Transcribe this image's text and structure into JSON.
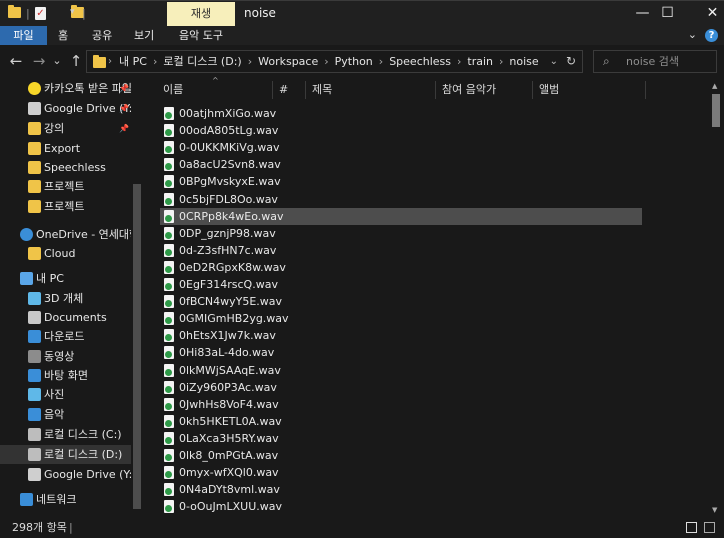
{
  "titlebar": {
    "context_tab": "재생",
    "title": "noise",
    "min_glyph": "—",
    "max_glyph": "☐",
    "close_glyph": "✕"
  },
  "ribbon": {
    "tabs": [
      "파일",
      "홈",
      "공유",
      "보기",
      "음악 도구"
    ],
    "help_glyph": "?"
  },
  "nav": {
    "back": "←",
    "forward": "→",
    "recent": "⌄",
    "up": "↑",
    "breadcrumb": [
      "내 PC",
      "로컬 디스크 (D:)",
      "Workspace",
      "Python",
      "Speechless",
      "train",
      "noise"
    ],
    "search_placeholder": "noise 검색"
  },
  "sidebar": {
    "items": [
      {
        "label": "카카오톡 받은 파일",
        "icon": "kakaotalk-icon",
        "pinned": true
      },
      {
        "label": "Google Drive (Y:)",
        "icon": "drive-icon",
        "pinned": true
      },
      {
        "label": "강의",
        "icon": "folder-icon",
        "pinned": true
      },
      {
        "label": "Export",
        "icon": "folder-icon",
        "pinned": false
      },
      {
        "label": "Speechless",
        "icon": "folder-icon",
        "pinned": false
      },
      {
        "label": "프로젝트",
        "icon": "folder-icon",
        "pinned": false
      },
      {
        "label": "프로젝트",
        "icon": "folder-icon",
        "pinned": false
      },
      {
        "label": "OneDrive - 연세대학교",
        "icon": "onedrive-icon",
        "pinned": false
      },
      {
        "label": "Cloud",
        "icon": "folder-icon",
        "pinned": false
      },
      {
        "label": "내 PC",
        "icon": "pc-icon",
        "pinned": false
      },
      {
        "label": "3D 개체",
        "icon": "3d-objects-icon",
        "pinned": false
      },
      {
        "label": "Documents",
        "icon": "documents-icon",
        "pinned": false
      },
      {
        "label": "다운로드",
        "icon": "download-icon",
        "pinned": false
      },
      {
        "label": "동영상",
        "icon": "video-icon",
        "pinned": false
      },
      {
        "label": "바탕 화면",
        "icon": "desktop-icon",
        "pinned": false
      },
      {
        "label": "사진",
        "icon": "pictures-icon",
        "pinned": false
      },
      {
        "label": "음악",
        "icon": "music-icon",
        "pinned": false
      },
      {
        "label": "로컬 디스크 (C:)",
        "icon": "disk-icon",
        "pinned": false
      },
      {
        "label": "로컬 디스크 (D:)",
        "icon": "disk-icon",
        "pinned": false,
        "selected": true
      },
      {
        "label": "Google Drive (Y:)",
        "icon": "drive-icon",
        "pinned": false
      },
      {
        "label": "네트워크",
        "icon": "network-icon",
        "pinned": false
      }
    ]
  },
  "columns": [
    "이름",
    "#",
    "제목",
    "참여 음악가",
    "앨범"
  ],
  "files": [
    "00atjhmXiGo.wav",
    "00odA805tLg.wav",
    "0-0UKKMKiVg.wav",
    "0a8acU2Svn8.wav",
    "0BPgMvskyxE.wav",
    "0c5bjFDL8Oo.wav",
    "0CRPp8k4wEo.wav",
    "0DP_gznjP98.wav",
    "0d-Z3sfHN7c.wav",
    "0eD2RGpxK8w.wav",
    "0EgF314rscQ.wav",
    "0fBCN4wyY5E.wav",
    "0GMIGmHB2yg.wav",
    "0hEtsX1Jw7k.wav",
    "0Hi83aL-4do.wav",
    "0lkMWjSAAqE.wav",
    "0iZy960P3Ac.wav",
    "0JwhHs8VoF4.wav",
    "0kh5HKETL0A.wav",
    "0LaXca3H5RY.wav",
    "0lk8_0mPGtA.wav",
    "0myx-wfXQl0.wav",
    "0N4aDYt8vml.wav",
    "0-oOuJmLXUU.wav"
  ],
  "selected_file": "0CRPp8k4wEo.wav",
  "status": {
    "item_count": "298개 항목"
  },
  "colors": {
    "background": "#191919",
    "file_tab": "#2d6aae",
    "context_tab": "#f7efbb",
    "selection": "#4d4d4d"
  }
}
